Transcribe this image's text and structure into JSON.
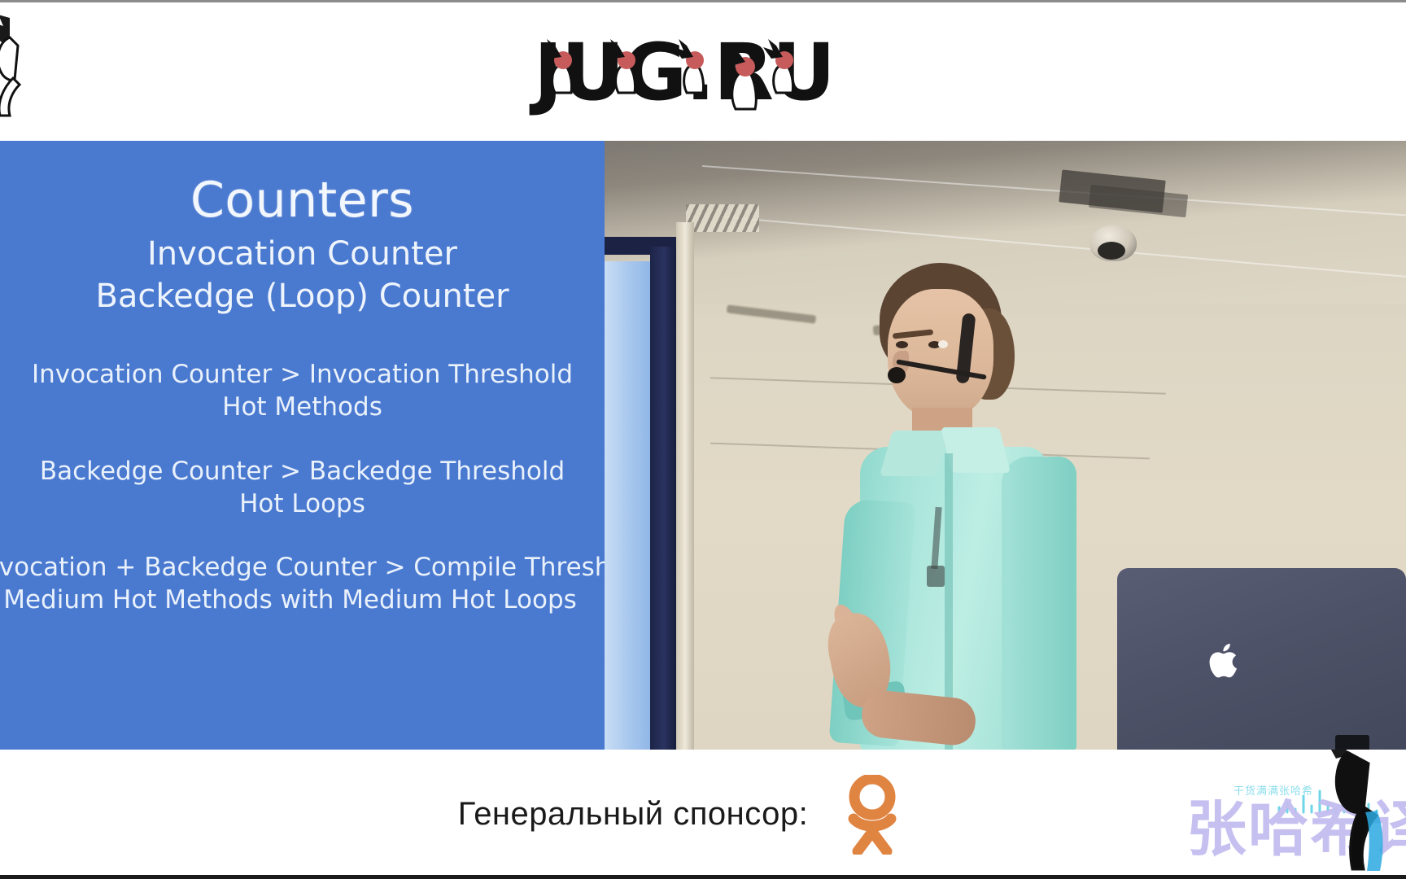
{
  "header": {
    "logo_text": "JUG.RU",
    "logo_name": "jugru-logo",
    "mascot_name": "java-duke-mascot"
  },
  "slide": {
    "background_color": "#4a79d0",
    "text_color": "#eef4fc",
    "title": "Counters",
    "subtitles": [
      "Invocation Counter",
      "Backedge (Loop) Counter"
    ],
    "rules": [
      {
        "condition": "Invocation Counter > Invocation Threshold",
        "result": "Hot Methods"
      },
      {
        "condition": "Backedge Counter > Backedge Threshold",
        "result": "Hot Loops"
      },
      {
        "condition": "Invocation + Backedge Counter > Compile Threshold",
        "result": "Medium Hot Methods with Medium Hot Loops"
      }
    ]
  },
  "video": {
    "name": "conference-talk-video",
    "description": "Speaker in mint shirt with headset microphone presenting in a conference room",
    "laptop_brand_icon": "apple-logo"
  },
  "footer": {
    "sponsor_label": "Генеральный спонсор:",
    "sponsor_logo_name": "odnoklassniki-logo",
    "sponsor_logo_color": "#e08442"
  },
  "watermark": {
    "main_text": "张哈希译",
    "sub_text": "干货满满张哈希",
    "main_color": "#c3bdf0",
    "sub_color": "#6fd6e8"
  }
}
